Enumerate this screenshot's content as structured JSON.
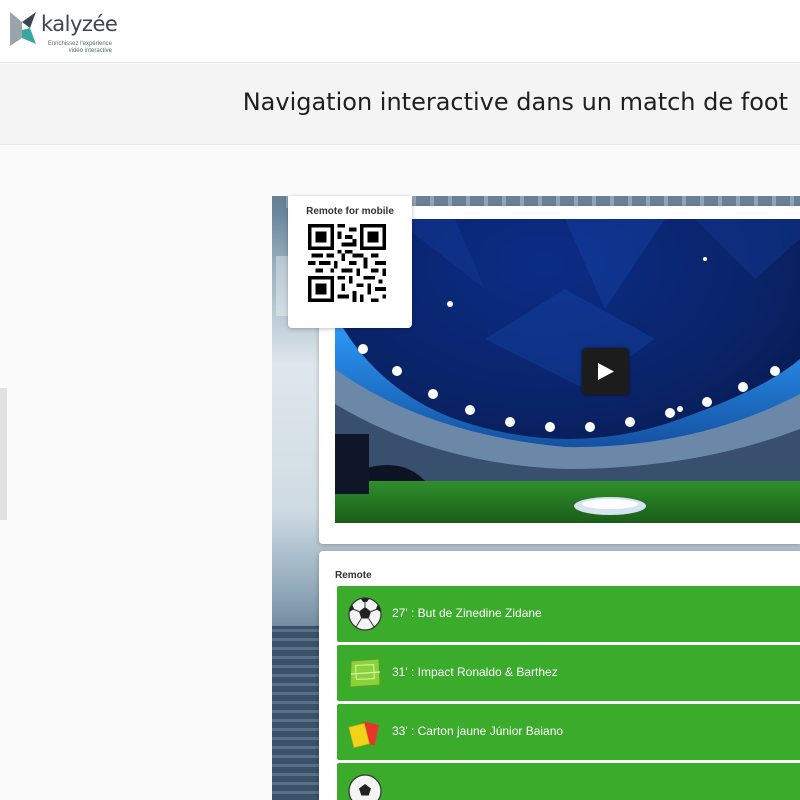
{
  "header": {
    "logo_name": "kalyzée",
    "logo_tagline_1": "Enrichissez l'expérience",
    "logo_tagline_2": "vidéo interactive"
  },
  "page": {
    "title": "Navigation interactive dans un match de foot"
  },
  "qr": {
    "title": "Remote for mobile"
  },
  "remote": {
    "title": "Remote",
    "events": [
      {
        "label": "27' : But de Zinedine Zidane",
        "icon": "soccer-ball-icon"
      },
      {
        "label": "31' : Impact Ronaldo & Barthez",
        "icon": "pitch-icon"
      },
      {
        "label": "33' : Carton jaune Júnior Baiano",
        "icon": "cards-icon"
      },
      {
        "label": "",
        "icon": "soccer-ball-icon"
      }
    ]
  },
  "colors": {
    "brand_teal": "#3aa6a1",
    "event_green": "#3aab2b",
    "yellow_card": "#f3d21a",
    "red_card": "#e8342a"
  }
}
